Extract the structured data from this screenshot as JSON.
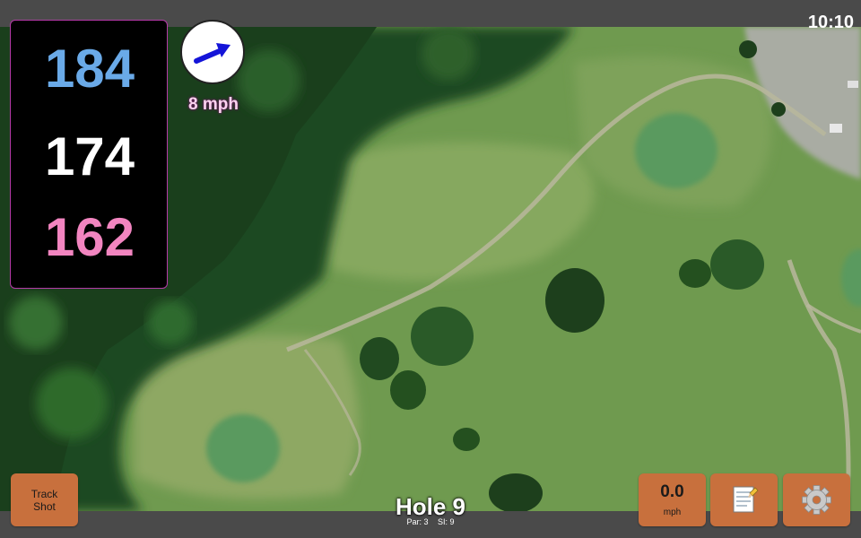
{
  "status": {
    "time": "10:10"
  },
  "distances": {
    "back": "184",
    "middle": "174",
    "front": "162"
  },
  "wind": {
    "speed_label": "8 mph",
    "icon": "wind-arrow-icon"
  },
  "hole": {
    "title": "Hole 9",
    "par": "Par: 3",
    "si": "SI: 9"
  },
  "buttons": {
    "track_shot": {
      "line1": "Track",
      "line2": "Shot"
    },
    "speed": {
      "value": "0.0",
      "unit": "mph"
    },
    "notes_icon": "notepad-icon",
    "settings_icon": "gear-icon"
  },
  "colors": {
    "back": "#6aaae8",
    "middle": "#ffffff",
    "front": "#f285c0",
    "button": "#c8703d",
    "panel_border": "#b53aa8"
  }
}
